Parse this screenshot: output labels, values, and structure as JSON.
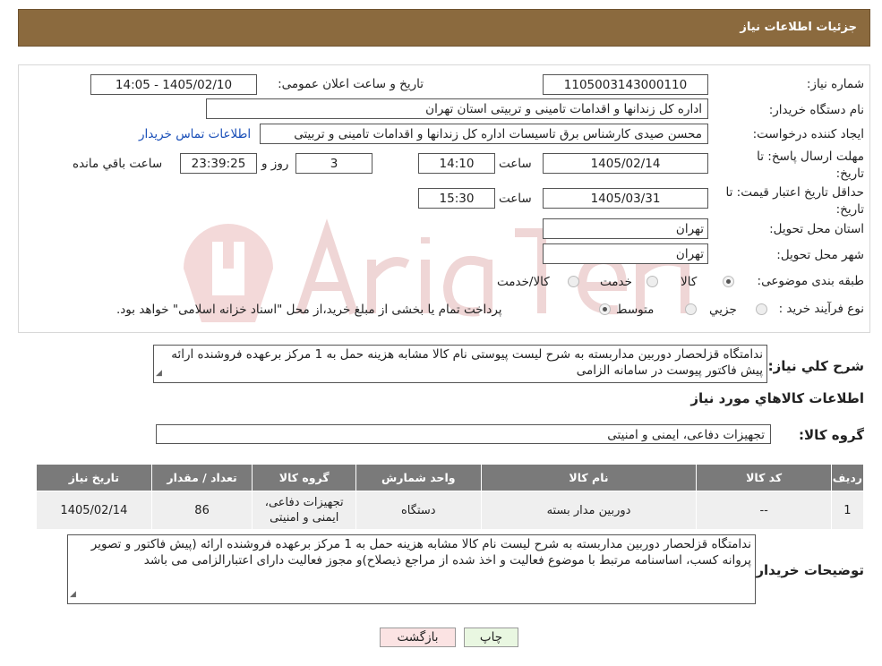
{
  "header": {
    "title": "جزئیات اطلاعات نیاز"
  },
  "fields": {
    "need_number_label": "شماره نیاز:",
    "need_number": "1105003143000110",
    "announce_label": "تاریخ و ساعت اعلان عمومی:",
    "announce_value": "1405/02/10 - 14:05",
    "buyer_label": "نام دستگاه خریدار:",
    "buyer_value": "اداره کل زندانها و اقدامات تامینی و تربیتی استان تهران",
    "creator_label": "ایجاد کننده درخواست:",
    "creator_value": "محسن صیدی کارشناس برق تاسیسات  اداره کل زندانها و اقدامات تامینی و تربیتی",
    "contact_link": "اطلاعات تماس خریدار",
    "deadline_label": "مهلت ارسال پاسخ: تا تاریخ:",
    "deadline_date": "1405/02/14",
    "time_label": "ساعت",
    "deadline_time": "14:10",
    "days_value": "3",
    "days_label": "روز و",
    "remaining_value": "23:39:25",
    "remaining_label": "ساعت باقي مانده",
    "validity_label": "حداقل تاریخ اعتبار قیمت: تا تاریخ:",
    "validity_date": "1405/03/31",
    "validity_time": "15:30",
    "province_label": "استان محل تحویل:",
    "province_value": "تهران",
    "city_label": "شهر محل تحویل:",
    "city_value": "تهران",
    "category_label": "طبقه بندی موضوعی:",
    "category_options": [
      "کالا",
      "خدمت",
      "کالا/خدمت"
    ],
    "process_label": "نوع فرآیند خرید :",
    "process_options": [
      "جزيي",
      "متوسط"
    ],
    "process_note": "پرداخت تمام یا بخشی از مبلغ خرید،از محل \"اسناد خزانه اسلامی\" خواهد بود."
  },
  "summary": {
    "label": "شرح کلي نياز:",
    "text": "ندامتگاه قزلحصار دوربین مداربسته به شرح لیست پیوستی نام کالا مشابه هزینه حمل به 1 مرکز برعهده فروشنده ارائه پیش فاکتور  پیوست در سامانه الزامی"
  },
  "goods": {
    "section_title": "اطلاعات کالاهاي مورد نياز",
    "group_label": "گروه کالا:",
    "group_value": "تجهیزات دفاعی، ایمنی و امنیتی"
  },
  "table": {
    "headers": [
      "رديف",
      "کد کالا",
      "نام کالا",
      "واحد شمارش",
      "گروه کالا",
      "تعداد / مقدار",
      "تاريخ نياز"
    ],
    "rows": [
      [
        "1",
        "--",
        "دوربین مدار بسته",
        "دستگاه",
        "تجهیزات دفاعی، ایمنی و امنیتی",
        "86",
        "1405/02/14"
      ]
    ]
  },
  "notes": {
    "label": "توضیحات خریدار:",
    "text": "ندامتگاه قزلحصار دوربین مداربسته به شرح لیست نام کالا مشابه هزینه حمل  به 1 مرکز برعهده فروشنده ارائه (پیش فاکتور و  تصویر پروانه کسب، اساسنامه مرتبط با موضوع فعالیت و اخذ شده از مراجع ذیصلاح)و مجوز فعالیت دارای اعتبارالزامی می باشد"
  },
  "buttons": {
    "print": "چاپ",
    "back": "بازگشت"
  },
  "colors": {
    "header": "#8b6a3e",
    "table_header": "#7a7a7a",
    "print_btn": "#e9f7e1",
    "back_btn": "#fbe3e3"
  }
}
